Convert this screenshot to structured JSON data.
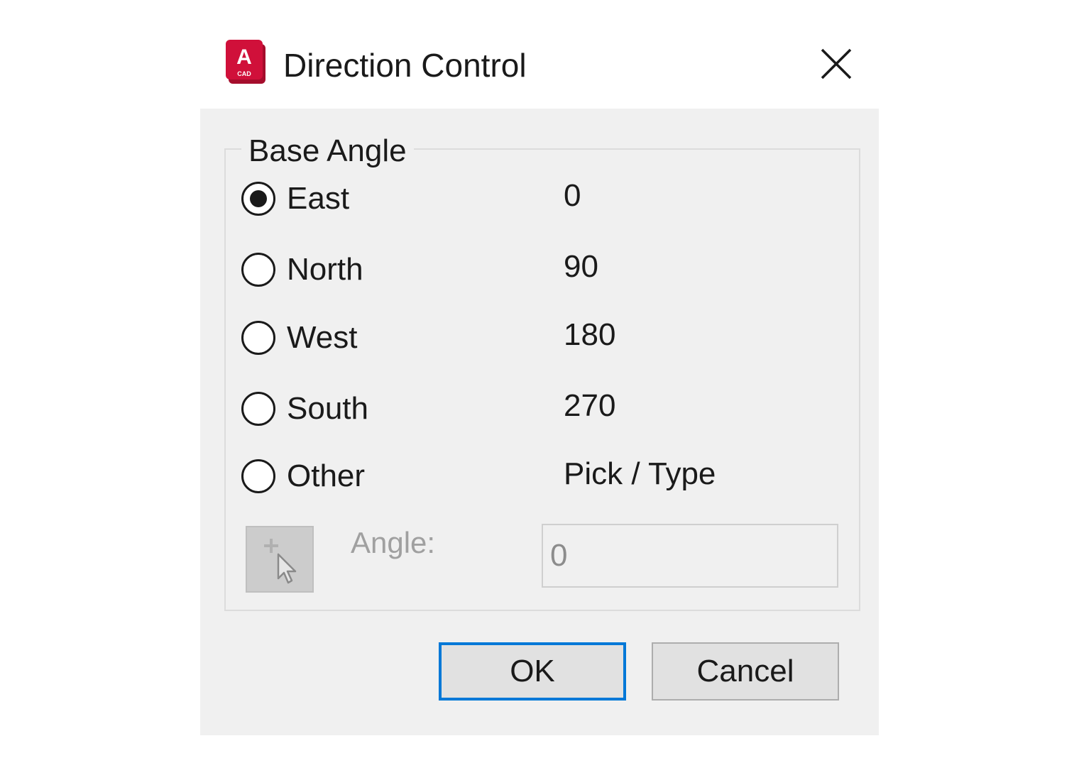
{
  "window": {
    "title": "Direction Control",
    "app_icon": "autocad-icon",
    "app_icon_letter": "A",
    "app_icon_caption": "CAD",
    "close_icon": "close-icon"
  },
  "base_angle_group": {
    "legend": "Base Angle",
    "options": [
      {
        "label": "East",
        "value": "0",
        "selected": true
      },
      {
        "label": "North",
        "value": "90",
        "selected": false
      },
      {
        "label": "West",
        "value": "180",
        "selected": false
      },
      {
        "label": "South",
        "value": "270",
        "selected": false
      },
      {
        "label": "Other",
        "value": "Pick / Type",
        "selected": false
      }
    ],
    "pick_button_icon": "pick-point-cursor-icon",
    "angle_label": "Angle:",
    "angle_value": "0"
  },
  "buttons": {
    "ok_label": "OK",
    "cancel_label": "Cancel"
  },
  "colors": {
    "dialog_background": "#f0f0f0",
    "default_button_border": "#0078d7",
    "app_icon_red": "#d0103a"
  }
}
